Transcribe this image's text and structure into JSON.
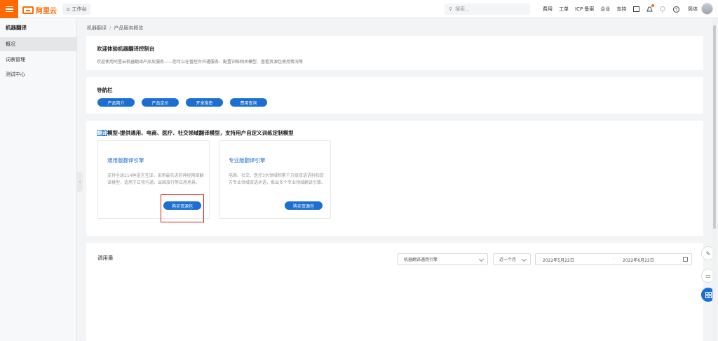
{
  "topbar": {
    "brand": "阿里云",
    "workbench": "工作台",
    "search_placeholder": "搜索...",
    "links": [
      "费用",
      "工单",
      "ICP 备案",
      "企业",
      "支持"
    ],
    "lang": "简体"
  },
  "sidebar": {
    "title": "机器翻译",
    "items": [
      {
        "label": "概况"
      },
      {
        "label": "词表管理"
      },
      {
        "label": "测试中心"
      }
    ]
  },
  "breadcrumb": [
    "机器翻译",
    "产品服务概览"
  ],
  "welcome": {
    "title": "欢迎体验机器翻译控制台",
    "desc": "欢迎使用阿里云机器翻译产品及服务——您可以在管控台开通服务、配置训练相关模型、查看资源包使用情况等"
  },
  "navbar": {
    "title": "导航栏",
    "buttons": [
      "产品简介",
      "产品定价",
      "开发指南",
      "费用查询"
    ]
  },
  "engines": {
    "title_highlight": "翻译",
    "title_rest": "模型-提供通用、电商、医疗、社交领域翻译模型，支持用户自定义训练定制模型",
    "cards": [
      {
        "title": "通用版翻译引擎",
        "desc": "支持全球214种语言互译，采用最先进的神经网络翻译模型，适用于日常沟通、出国旅行等应用场景。",
        "button": "购买资源包"
      },
      {
        "title": "专业版翻译引擎",
        "desc": "电商、社交、医疗3大领域积累千万级双语语料和百万专业领域双语术语，推出多个专业领域翻译引擎。",
        "button": "购买资源包"
      }
    ]
  },
  "usage": {
    "title": "调用量",
    "engine_select": "机器翻译通用引擎",
    "period_select": "近一个月",
    "date_start": "2022年5月22日",
    "date_sep": "-",
    "date_end": "2022年6月22日"
  },
  "colors": {
    "brand": "#ff6a00",
    "primary": "#1b6fd1",
    "highlight_box": "#e02020"
  },
  "icons": {
    "float": [
      "edit-icon",
      "feedback-icon",
      "apps-icon"
    ]
  }
}
